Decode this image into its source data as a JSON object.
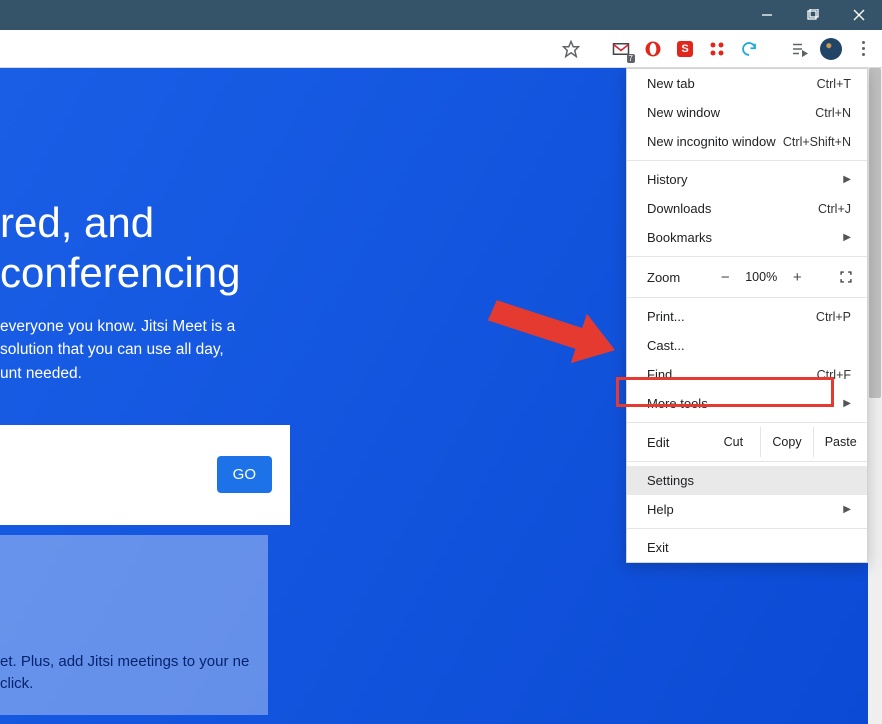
{
  "titlebar": {},
  "toolbar": {
    "gmail_badge": "7"
  },
  "page": {
    "headline_line1": "red, and",
    "headline_line2": "conferencing",
    "desc": "everyone you know. Jitsi Meet is a solution that you can use all day, unt needed.",
    "go_label": "GO",
    "second_text": "et. Plus, add Jitsi meetings to your ne click."
  },
  "menu": {
    "new_tab": "New tab",
    "new_tab_sc": "Ctrl+T",
    "new_window": "New window",
    "new_window_sc": "Ctrl+N",
    "new_incognito": "New incognito window",
    "new_incognito_sc": "Ctrl+Shift+N",
    "history": "History",
    "downloads": "Downloads",
    "downloads_sc": "Ctrl+J",
    "bookmarks": "Bookmarks",
    "zoom_label": "Zoom",
    "zoom_minus": "−",
    "zoom_value": "100%",
    "zoom_plus": "+",
    "print": "Print...",
    "print_sc": "Ctrl+P",
    "cast": "Cast...",
    "find": "Find...",
    "find_sc": "Ctrl+F",
    "more_tools": "More tools",
    "edit": "Edit",
    "cut": "Cut",
    "copy": "Copy",
    "paste": "Paste",
    "settings": "Settings",
    "help": "Help",
    "exit": "Exit"
  }
}
